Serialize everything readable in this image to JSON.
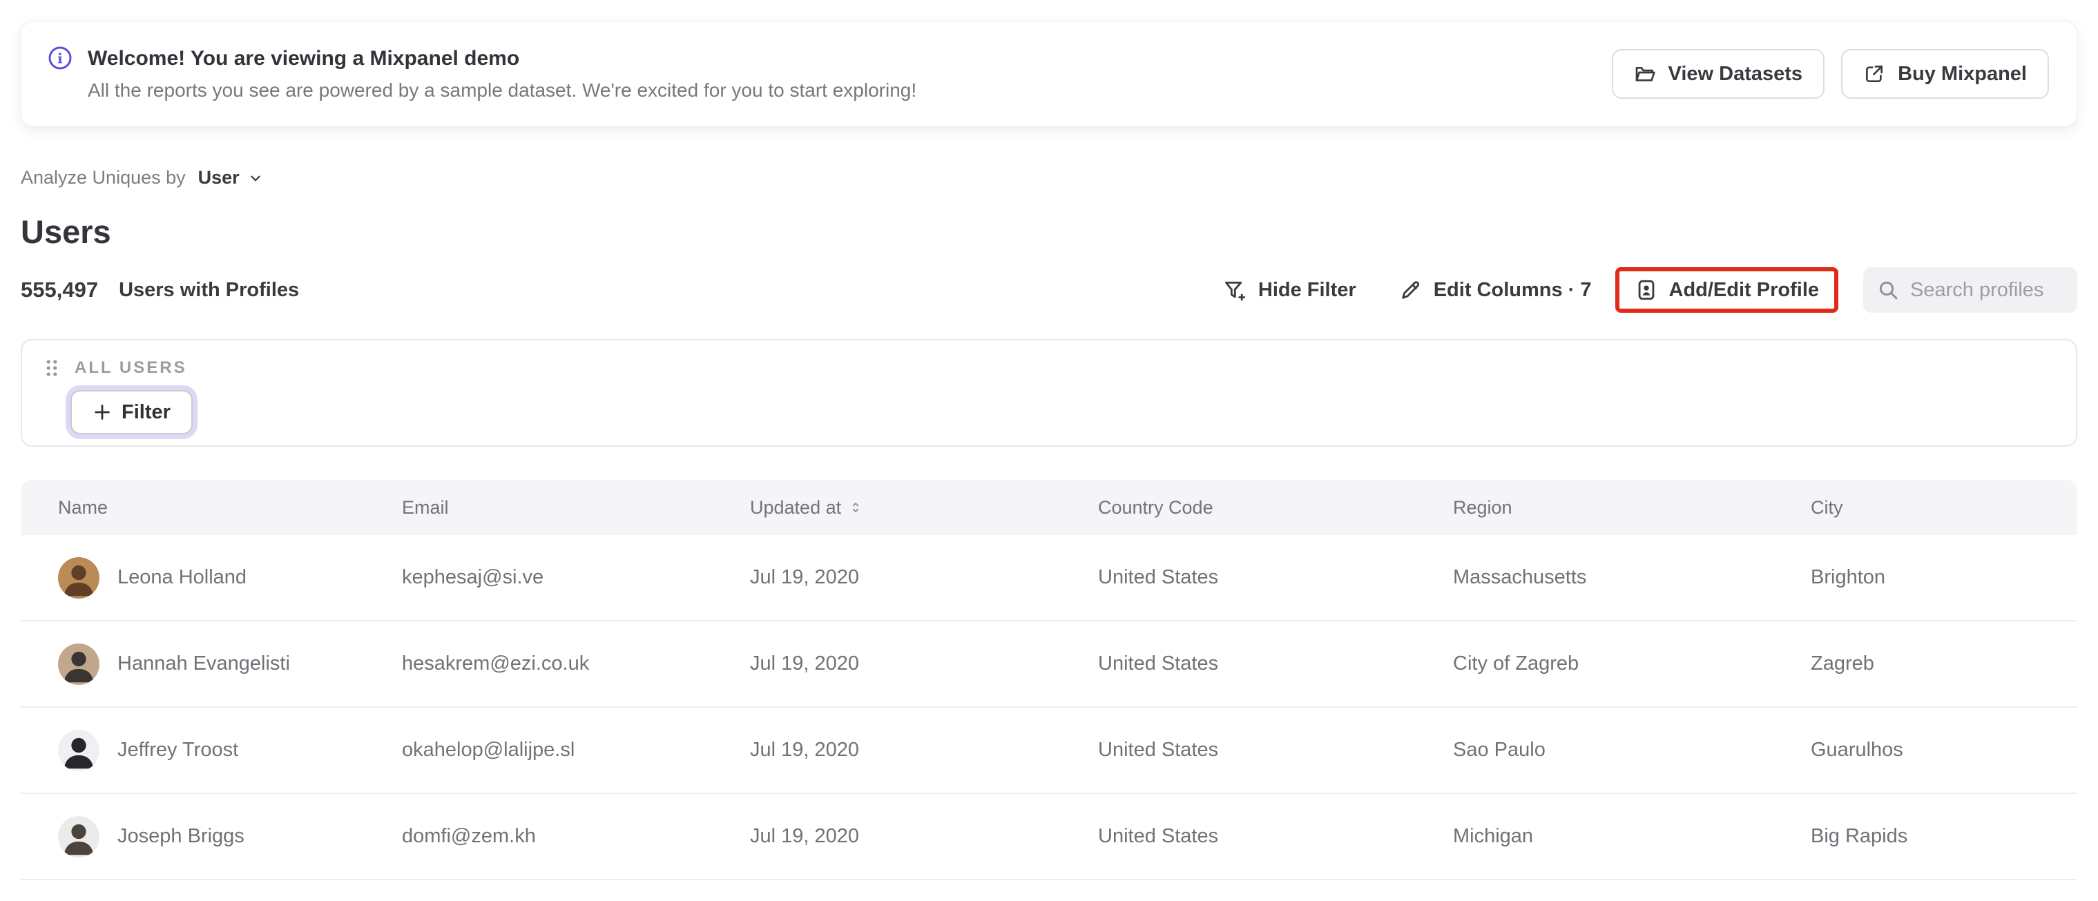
{
  "colors": {
    "accent_purple": "#5a4fe0",
    "highlight_red": "#e12b17",
    "focus_ring_purple": "#dcd9f7",
    "table_header_bg": "#f5f4f6",
    "search_bg": "#f1f1f3"
  },
  "banner": {
    "icon": "info-circle-icon",
    "title": "Welcome! You are viewing a Mixpanel demo",
    "subtitle": "All the reports you see are powered by a sample dataset. We're excited for you to start exploring!",
    "view_datasets_label": "View Datasets",
    "view_datasets_icon": "folder-icon",
    "buy_mixpanel_label": "Buy Mixpanel",
    "buy_mixpanel_icon": "external-link-icon"
  },
  "controls": {
    "analyze_label": "Analyze Uniques by",
    "analyze_value": "User",
    "analyze_icon": "chevron-down-icon",
    "page_title": "Users",
    "count": "555,497",
    "count_label": "Users with Profiles",
    "hide_filter_label": "Hide Filter",
    "hide_filter_icon": "funnel-plus-icon",
    "edit_columns_label": "Edit Columns · 7",
    "edit_columns_icon": "pencil-icon",
    "add_edit_profile_label": "Add/Edit Profile",
    "add_edit_profile_icon": "id-badge-icon",
    "search_placeholder": "Search profiles",
    "search_icon": "search-icon"
  },
  "filter_panel": {
    "drag_icon": "drag-handle-icon",
    "group_label": "ALL USERS",
    "add_filter_icon": "plus-icon",
    "add_filter_label": "Filter"
  },
  "table": {
    "columns": [
      "Name",
      "Email",
      "Updated at",
      "Country Code",
      "Region",
      "City"
    ],
    "sort_icon": "sort-arrows-icon",
    "sorted_column": "Updated at",
    "rows": [
      {
        "name": "Leona Holland",
        "email": "kephesaj@si.ve",
        "updated": "Jul 19, 2020",
        "country": "United States",
        "region": "Massachusetts",
        "city": "Brighton",
        "avatar_bg": "#bb8a55",
        "avatar_fg": "#5f4026"
      },
      {
        "name": "Hannah Evangelisti",
        "email": "hesakrem@ezi.co.uk",
        "updated": "Jul 19, 2020",
        "country": "United States",
        "region": "City of Zagreb",
        "city": "Zagreb",
        "avatar_bg": "#c3a78d",
        "avatar_fg": "#3a3532"
      },
      {
        "name": "Jeffrey Troost",
        "email": "okahelop@lalijpe.sl",
        "updated": "Jul 19, 2020",
        "country": "United States",
        "region": "Sao Paulo",
        "city": "Guarulhos",
        "avatar_bg": "#f0f0f2",
        "avatar_fg": "#26262b"
      },
      {
        "name": "Joseph Briggs",
        "email": "domfi@zem.kh",
        "updated": "Jul 19, 2020",
        "country": "United States",
        "region": "Michigan",
        "city": "Big Rapids",
        "avatar_bg": "#ebebeb",
        "avatar_fg": "#4a443c"
      }
    ]
  }
}
